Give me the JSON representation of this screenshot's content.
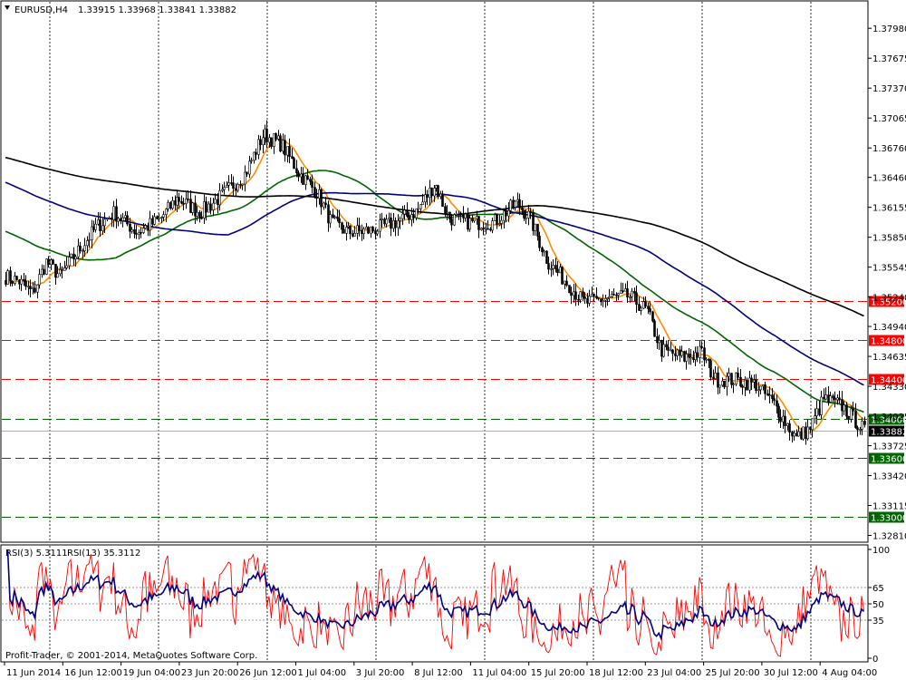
{
  "header": {
    "symbol_tf": "EURUSD,H4",
    "ohlc": "1.33915 1.33968 1.33841 1.33882"
  },
  "rsi_header": {
    "label1": "RSI(3) 5.3111",
    "label2": "RSI(13) 35.3112"
  },
  "copyright": "Profit-Trader, © 2001-2014, MetaQuotes Software Corp.",
  "colors": {
    "price_line": "#ff0000",
    "support_line": "#006600",
    "ma_fast": "#ff8c00",
    "ma_green": "#006400",
    "ma_navy": "#000080",
    "ma_black": "#000000",
    "rsi_fast": "#ff0000",
    "rsi_slow": "#000080"
  },
  "chart_data": {
    "type": "line",
    "series_kind": "candlestick",
    "price_ticks": [
      "1.37980",
      "1.37675",
      "1.37370",
      "1.37065",
      "1.36760",
      "1.36460",
      "1.36155",
      "1.35850",
      "1.35545",
      "1.35240",
      "1.34940",
      "1.34635",
      "1.34330",
      "1.34025",
      "1.33725",
      "1.33420",
      "1.33115",
      "1.32810"
    ],
    "ylim": [
      1.3275,
      1.3825
    ],
    "hlines": [
      {
        "value": 1.352,
        "label": "1.35200",
        "kind": "resistance"
      },
      {
        "value": 1.348,
        "label": "1.34800",
        "kind": "resistance"
      },
      {
        "value": 1.344,
        "label": "1.34400",
        "kind": "resistance"
      },
      {
        "value": 1.34,
        "label": "1.34000",
        "kind": "support"
      },
      {
        "value": 1.336,
        "label": "1.33600",
        "kind": "support"
      },
      {
        "value": 1.33,
        "label": "1.33000",
        "kind": "support"
      }
    ],
    "current_price": {
      "value": 1.33882,
      "label": "1.33882"
    },
    "x_labels": [
      "11 Jun 2014",
      "16 Jun 12:00",
      "19 Jun 04:00",
      "23 Jun 20:00",
      "26 Jun 12:00",
      "1 Jul 04:00",
      "3 Jul 20:00",
      "8 Jul 12:00",
      "11 Jul 04:00",
      "15 Jul 20:00",
      "18 Jul 12:00",
      "23 Jul 04:00",
      "25 Jul 20:00",
      "30 Jul 12:00",
      "4 Aug 04:00"
    ],
    "close_anchors": [
      [
        0,
        1.3545
      ],
      [
        6,
        1.354
      ],
      [
        12,
        1.3528
      ],
      [
        18,
        1.356
      ],
      [
        24,
        1.3545
      ],
      [
        30,
        1.3565
      ],
      [
        40,
        1.3595
      ],
      [
        48,
        1.361
      ],
      [
        58,
        1.359
      ],
      [
        68,
        1.3603
      ],
      [
        76,
        1.3625
      ],
      [
        86,
        1.361
      ],
      [
        96,
        1.3628
      ],
      [
        106,
        1.365
      ],
      [
        114,
        1.369
      ],
      [
        122,
        1.368
      ],
      [
        130,
        1.365
      ],
      [
        138,
        1.363
      ],
      [
        144,
        1.36
      ],
      [
        152,
        1.359
      ],
      [
        162,
        1.3592
      ],
      [
        172,
        1.36
      ],
      [
        182,
        1.3612
      ],
      [
        190,
        1.364
      ],
      [
        196,
        1.3605
      ],
      [
        206,
        1.36
      ],
      [
        216,
        1.36
      ],
      [
        226,
        1.362
      ],
      [
        232,
        1.3605
      ],
      [
        240,
        1.356
      ],
      [
        248,
        1.354
      ],
      [
        256,
        1.3518
      ],
      [
        266,
        1.3523
      ],
      [
        276,
        1.3525
      ],
      [
        284,
        1.351
      ],
      [
        290,
        1.347
      ],
      [
        300,
        1.3462
      ],
      [
        308,
        1.3468
      ],
      [
        314,
        1.344
      ],
      [
        322,
        1.344
      ],
      [
        332,
        1.3435
      ],
      [
        340,
        1.3415
      ],
      [
        350,
        1.338
      ],
      [
        356,
        1.339
      ],
      [
        362,
        1.342
      ],
      [
        370,
        1.3413
      ],
      [
        376,
        1.3398
      ],
      [
        380,
        1.3388
      ]
    ],
    "ma_periods": [
      10,
      50,
      100,
      200
    ],
    "rsi_ticks": [
      "100",
      "65",
      "50",
      "35",
      "0"
    ],
    "rsi_levels": [
      65,
      50,
      35
    ]
  }
}
